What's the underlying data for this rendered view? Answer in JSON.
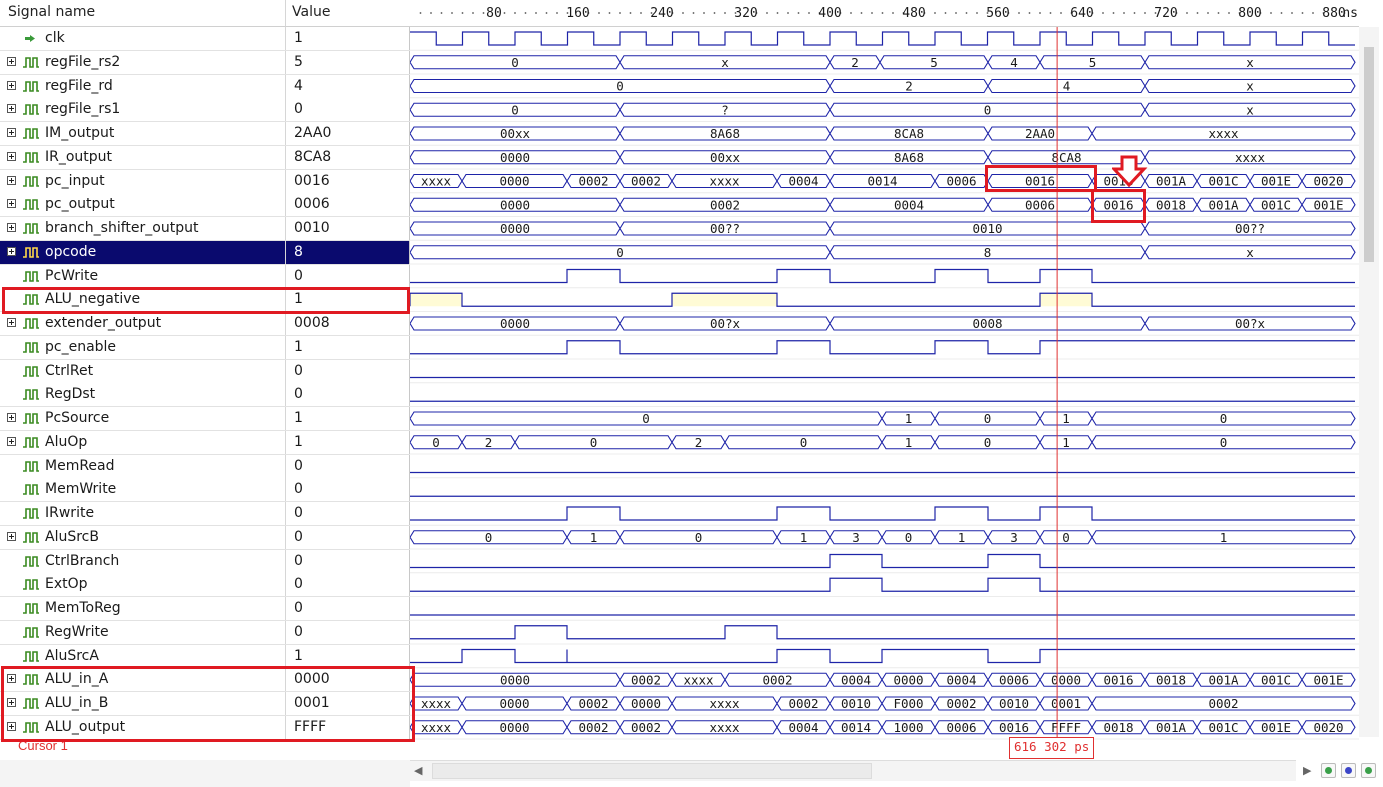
{
  "header": {
    "signal_name": "Signal name",
    "value": "Value",
    "unit": "ns",
    "ticks": [
      "80",
      "160",
      "240",
      "320",
      "400",
      "480",
      "560",
      "640",
      "720",
      "800",
      "880"
    ]
  },
  "signals": [
    {
      "name": "clk",
      "value": "1",
      "type": "clk"
    },
    {
      "name": "regFile_rs2",
      "value": "5",
      "type": "bus",
      "segs": [
        [
          "0",
          0,
          210
        ],
        [
          "x",
          210,
          420
        ],
        [
          "2",
          420,
          470
        ],
        [
          "5",
          470,
          578
        ],
        [
          "4",
          578,
          630
        ],
        [
          "5",
          630,
          735
        ],
        [
          "x",
          735,
          945
        ]
      ]
    },
    {
      "name": "regFile_rd",
      "value": "4",
      "type": "bus",
      "segs": [
        [
          "0",
          0,
          420
        ],
        [
          "2",
          420,
          578
        ],
        [
          "4",
          578,
          735
        ],
        [
          "x",
          735,
          945
        ]
      ]
    },
    {
      "name": "regFile_rs1",
      "value": "0",
      "type": "bus",
      "segs": [
        [
          "0",
          0,
          210
        ],
        [
          "?",
          210,
          420
        ],
        [
          "0",
          420,
          735
        ],
        [
          "x",
          735,
          945
        ]
      ]
    },
    {
      "name": "IM_output",
      "value": "2AA0",
      "type": "bus",
      "segs": [
        [
          "00xx",
          0,
          210
        ],
        [
          "8A68",
          210,
          420
        ],
        [
          "8CA8",
          420,
          578
        ],
        [
          "2AA0",
          578,
          682
        ],
        [
          "xxxx",
          682,
          945
        ]
      ]
    },
    {
      "name": "IR_output",
      "value": "8CA8",
      "type": "bus",
      "segs": [
        [
          "0000",
          0,
          210
        ],
        [
          "00xx",
          210,
          420
        ],
        [
          "8A68",
          420,
          578
        ],
        [
          "8CA8",
          578,
          735
        ],
        [
          "xxxx",
          735,
          945
        ]
      ]
    },
    {
      "name": "pc_input",
      "value": "0016",
      "type": "bus",
      "segs": [
        [
          "xxxx",
          0,
          52
        ],
        [
          "0000",
          52,
          157
        ],
        [
          "0002",
          157,
          210
        ],
        [
          "0002",
          210,
          262
        ],
        [
          "xxxx",
          262,
          367
        ],
        [
          "0004",
          367,
          420
        ],
        [
          "0014",
          420,
          525
        ],
        [
          "0006",
          525,
          578
        ],
        [
          "0016",
          578,
          682
        ],
        [
          "0018",
          682,
          735
        ],
        [
          "001A",
          735,
          787
        ],
        [
          "001C",
          787,
          840
        ],
        [
          "001E",
          840,
          892
        ],
        [
          "0020",
          892,
          945
        ]
      ]
    },
    {
      "name": "pc_output",
      "value": "0006",
      "type": "bus",
      "segs": [
        [
          "0000",
          0,
          210
        ],
        [
          "0002",
          210,
          420
        ],
        [
          "0004",
          420,
          578
        ],
        [
          "0006",
          578,
          682
        ],
        [
          "0016",
          682,
          735
        ],
        [
          "0018",
          735,
          787
        ],
        [
          "001A",
          787,
          840
        ],
        [
          "001C",
          840,
          892
        ],
        [
          "001E",
          892,
          945
        ]
      ]
    },
    {
      "name": "branch_shifter_output",
      "value": "0010",
      "type": "bus",
      "segs": [
        [
          "0000",
          0,
          210
        ],
        [
          "00??",
          210,
          420
        ],
        [
          "0010",
          420,
          735
        ],
        [
          "00??",
          735,
          945
        ]
      ]
    },
    {
      "name": "opcode",
      "value": "8",
      "type": "bus",
      "selected": true,
      "segs": [
        [
          "0",
          0,
          420
        ],
        [
          "8",
          420,
          735
        ],
        [
          "x",
          735,
          945
        ]
      ]
    },
    {
      "name": "PcWrite",
      "value": "0",
      "type": "bit",
      "hi": [
        [
          157,
          210
        ],
        [
          367,
          420
        ],
        [
          525,
          578
        ],
        [
          630,
          682
        ]
      ]
    },
    {
      "name": "ALU_negative",
      "value": "1",
      "type": "bitfill",
      "hi": [
        [
          0,
          52
        ],
        [
          262,
          367
        ],
        [
          630,
          682
        ]
      ]
    },
    {
      "name": "extender_output",
      "value": "0008",
      "type": "bus",
      "segs": [
        [
          "0000",
          0,
          210
        ],
        [
          "00?x",
          210,
          420
        ],
        [
          "0008",
          420,
          735
        ],
        [
          "00?x",
          735,
          945
        ]
      ]
    },
    {
      "name": "pc_enable",
      "value": "1",
      "type": "bit",
      "hi": [
        [
          157,
          210
        ],
        [
          367,
          420
        ],
        [
          525,
          578
        ],
        [
          630,
          945
        ]
      ]
    },
    {
      "name": "CtrlRet",
      "value": "0",
      "type": "bit",
      "hi": []
    },
    {
      "name": "RegDst",
      "value": "0",
      "type": "bit",
      "hi": []
    },
    {
      "name": "PcSource",
      "value": "1",
      "type": "bus",
      "segs": [
        [
          "0",
          0,
          472
        ],
        [
          "1",
          472,
          525
        ],
        [
          "0",
          525,
          630
        ],
        [
          "1",
          630,
          682
        ],
        [
          "0",
          682,
          945
        ]
      ]
    },
    {
      "name": "AluOp",
      "value": "1",
      "type": "bus",
      "segs": [
        [
          "0",
          0,
          52
        ],
        [
          "2",
          52,
          105
        ],
        [
          "0",
          105,
          262
        ],
        [
          "2",
          262,
          315
        ],
        [
          "0",
          315,
          472
        ],
        [
          "1",
          472,
          525
        ],
        [
          "0",
          525,
          630
        ],
        [
          "1",
          630,
          682
        ],
        [
          "0",
          682,
          945
        ]
      ]
    },
    {
      "name": "MemRead",
      "value": "0",
      "type": "bit",
      "hi": []
    },
    {
      "name": "MemWrite",
      "value": "0",
      "type": "bit",
      "hi": []
    },
    {
      "name": "IRwrite",
      "value": "0",
      "type": "bit",
      "hi": [
        [
          157,
          210
        ],
        [
          367,
          420
        ],
        [
          525,
          578
        ],
        [
          630,
          682
        ]
      ]
    },
    {
      "name": "AluSrcB",
      "value": "0",
      "type": "bus",
      "segs": [
        [
          "0",
          0,
          157
        ],
        [
          "1",
          157,
          210
        ],
        [
          "0",
          210,
          367
        ],
        [
          "1",
          367,
          420
        ],
        [
          "3",
          420,
          472
        ],
        [
          "0",
          472,
          525
        ],
        [
          "1",
          525,
          578
        ],
        [
          "3",
          578,
          630
        ],
        [
          "0",
          630,
          682
        ],
        [
          "1",
          682,
          945
        ]
      ]
    },
    {
      "name": "CtrlBranch",
      "value": "0",
      "type": "bit",
      "hi": [
        [
          420,
          472
        ],
        [
          578,
          630
        ]
      ]
    },
    {
      "name": "ExtOp",
      "value": "0",
      "type": "bit",
      "hi": [
        [
          420,
          472
        ],
        [
          578,
          630
        ]
      ]
    },
    {
      "name": "MemToReg",
      "value": "0",
      "type": "bit",
      "hi": []
    },
    {
      "name": "RegWrite",
      "value": "0",
      "type": "bit",
      "hi": [
        [
          105,
          157
        ],
        [
          315,
          367
        ]
      ]
    },
    {
      "name": "AluSrcA",
      "value": "1",
      "type": "bit",
      "hi": [
        [
          52,
          945
        ]
      ],
      "lo_gaps": [
        [
          105,
          157
        ],
        [
          157,
          367
        ],
        [
          420,
          472
        ],
        [
          578,
          630
        ]
      ]
    },
    {
      "name": "ALU_in_A",
      "value": "0000",
      "type": "bus",
      "segs": [
        [
          "0000",
          0,
          210
        ],
        [
          "0002",
          210,
          262
        ],
        [
          "xxxx",
          262,
          315
        ],
        [
          "0002",
          315,
          420
        ],
        [
          "0004",
          420,
          472
        ],
        [
          "0000",
          472,
          525
        ],
        [
          "0004",
          525,
          578
        ],
        [
          "0006",
          578,
          630
        ],
        [
          "0000",
          630,
          682
        ],
        [
          "0016",
          682,
          735
        ],
        [
          "0018",
          735,
          787
        ],
        [
          "001A",
          787,
          840
        ],
        [
          "001C",
          840,
          892
        ],
        [
          "001E",
          892,
          945
        ]
      ]
    },
    {
      "name": "ALU_in_B",
      "value": "0001",
      "type": "bus",
      "segs": [
        [
          "xxxx",
          0,
          52
        ],
        [
          "0000",
          52,
          157
        ],
        [
          "0002",
          157,
          210
        ],
        [
          "0000",
          210,
          262
        ],
        [
          "xxxx",
          262,
          367
        ],
        [
          "0002",
          367,
          420
        ],
        [
          "0010",
          420,
          472
        ],
        [
          "F000",
          472,
          525
        ],
        [
          "0002",
          525,
          578
        ],
        [
          "0010",
          578,
          630
        ],
        [
          "0001",
          630,
          682
        ],
        [
          "0002",
          682,
          945
        ]
      ]
    },
    {
      "name": "ALU_output",
      "value": "FFFF",
      "type": "bus",
      "segs": [
        [
          "xxxx",
          0,
          52
        ],
        [
          "0000",
          52,
          157
        ],
        [
          "0002",
          157,
          210
        ],
        [
          "0002",
          210,
          262
        ],
        [
          "xxxx",
          262,
          367
        ],
        [
          "0004",
          367,
          420
        ],
        [
          "0014",
          420,
          472
        ],
        [
          "1000",
          472,
          525
        ],
        [
          "0006",
          525,
          578
        ],
        [
          "0016",
          578,
          630
        ],
        [
          "FFFF",
          630,
          682
        ],
        [
          "0018",
          682,
          735
        ],
        [
          "001A",
          735,
          787
        ],
        [
          "001C",
          787,
          840
        ],
        [
          "001E",
          840,
          892
        ],
        [
          "0020",
          892,
          945
        ]
      ]
    }
  ],
  "cursor": {
    "label": "Cursor 1",
    "time": "616 302 ps"
  },
  "colors": {
    "wave": "#1e24a8",
    "cursor": "#e03030",
    "highlight": "#e01a22",
    "fill": "#fffbd6",
    "selected": "#0a0a6e"
  }
}
